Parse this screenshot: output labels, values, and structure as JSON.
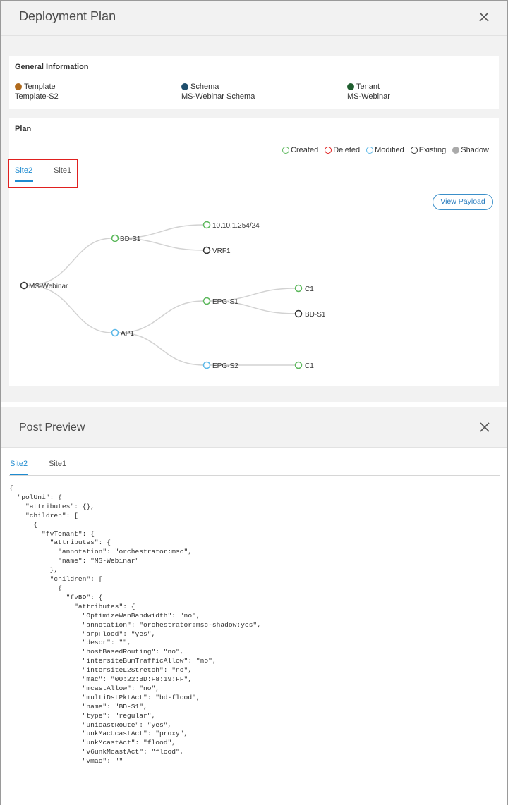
{
  "deployment_plan": {
    "title": "Deployment Plan",
    "general_information": {
      "heading": "General Information",
      "items": [
        {
          "label": "Template",
          "value": "Template-S2",
          "color": "#b06a1c"
        },
        {
          "label": "Schema",
          "value": "MS-Webinar Schema",
          "color": "#1d4d6c"
        },
        {
          "label": "Tenant",
          "value": "MS-Webinar",
          "color": "#1f5e2f"
        }
      ]
    },
    "plan": {
      "heading": "Plan",
      "legend": [
        {
          "label": "Created",
          "color": "#5cb85c",
          "filled": false
        },
        {
          "label": "Deleted",
          "color": "#e0201f",
          "filled": false
        },
        {
          "label": "Modified",
          "color": "#5bb8e8",
          "filled": false
        },
        {
          "label": "Existing",
          "color": "#333333",
          "filled": false
        },
        {
          "label": "Shadow",
          "color": "#aaaaaa",
          "filled": true
        }
      ],
      "tabs": [
        {
          "label": "Site2",
          "active": true
        },
        {
          "label": "Site1",
          "active": false
        }
      ],
      "view_payload_label": "View Payload",
      "tree": {
        "root": "MS-Webinar",
        "nodes": {
          "ms_webinar": "MS-Webinar",
          "bd_s1": "BD-S1",
          "subnet": "10.10.1.254/24",
          "vrf1": "VRF1",
          "ap1": "AP1",
          "epg_s1": "EPG-S1",
          "epg_s1_c1": "C1",
          "epg_s1_bd": "BD-S1",
          "epg_s2": "EPG-S2",
          "epg_s2_c1": "C1"
        },
        "statuses": {
          "ms_webinar": "Existing",
          "bd_s1": "Created",
          "subnet": "Created",
          "vrf1": "Existing",
          "ap1": "Modified",
          "epg_s1": "Created",
          "epg_s1_c1": "Created",
          "epg_s1_bd": "Existing",
          "epg_s2": "Modified",
          "epg_s2_c1": "Created"
        }
      }
    }
  },
  "post_preview": {
    "title": "Post Preview",
    "tabs": [
      {
        "label": "Site2",
        "active": true
      },
      {
        "label": "Site1",
        "active": false
      }
    ],
    "code_lines": [
      "{",
      "  \"polUni\": {",
      "    \"attributes\": {},",
      "    \"children\": [",
      "      {",
      "        \"fvTenant\": {",
      "          \"attributes\": {",
      "            \"annotation\": \"orchestrator:msc\",",
      "            \"name\": \"MS-Webinar\"",
      "          },",
      "          \"children\": [",
      "            {",
      "              \"fvBD\": {",
      "                \"attributes\": {",
      "                  \"OptimizeWanBandwidth\": \"no\",",
      "                  \"annotation\": \"orchestrator:msc-shadow:yes\",",
      "                  \"arpFlood\": \"yes\",",
      "                  \"descr\": \"\",",
      "                  \"hostBasedRouting\": \"no\",",
      "                  \"intersiteBumTrafficAllow\": \"no\",",
      "                  \"intersiteL2Stretch\": \"no\",",
      "                  \"mac\": \"00:22:BD:F8:19:FF\",",
      "                  \"mcastAllow\": \"no\",",
      "                  \"multiDstPktAct\": \"bd-flood\",",
      "                  \"name\": \"BD-S1\",",
      "                  \"type\": \"regular\",",
      "                  \"unicastRoute\": \"yes\",",
      "                  \"unkMacUcastAct\": \"proxy\",",
      "                  \"unkMcastAct\": \"flood\",",
      "                  \"v6unkMcastAct\": \"flood\",",
      "                  \"vmac\": \"\""
    ]
  }
}
